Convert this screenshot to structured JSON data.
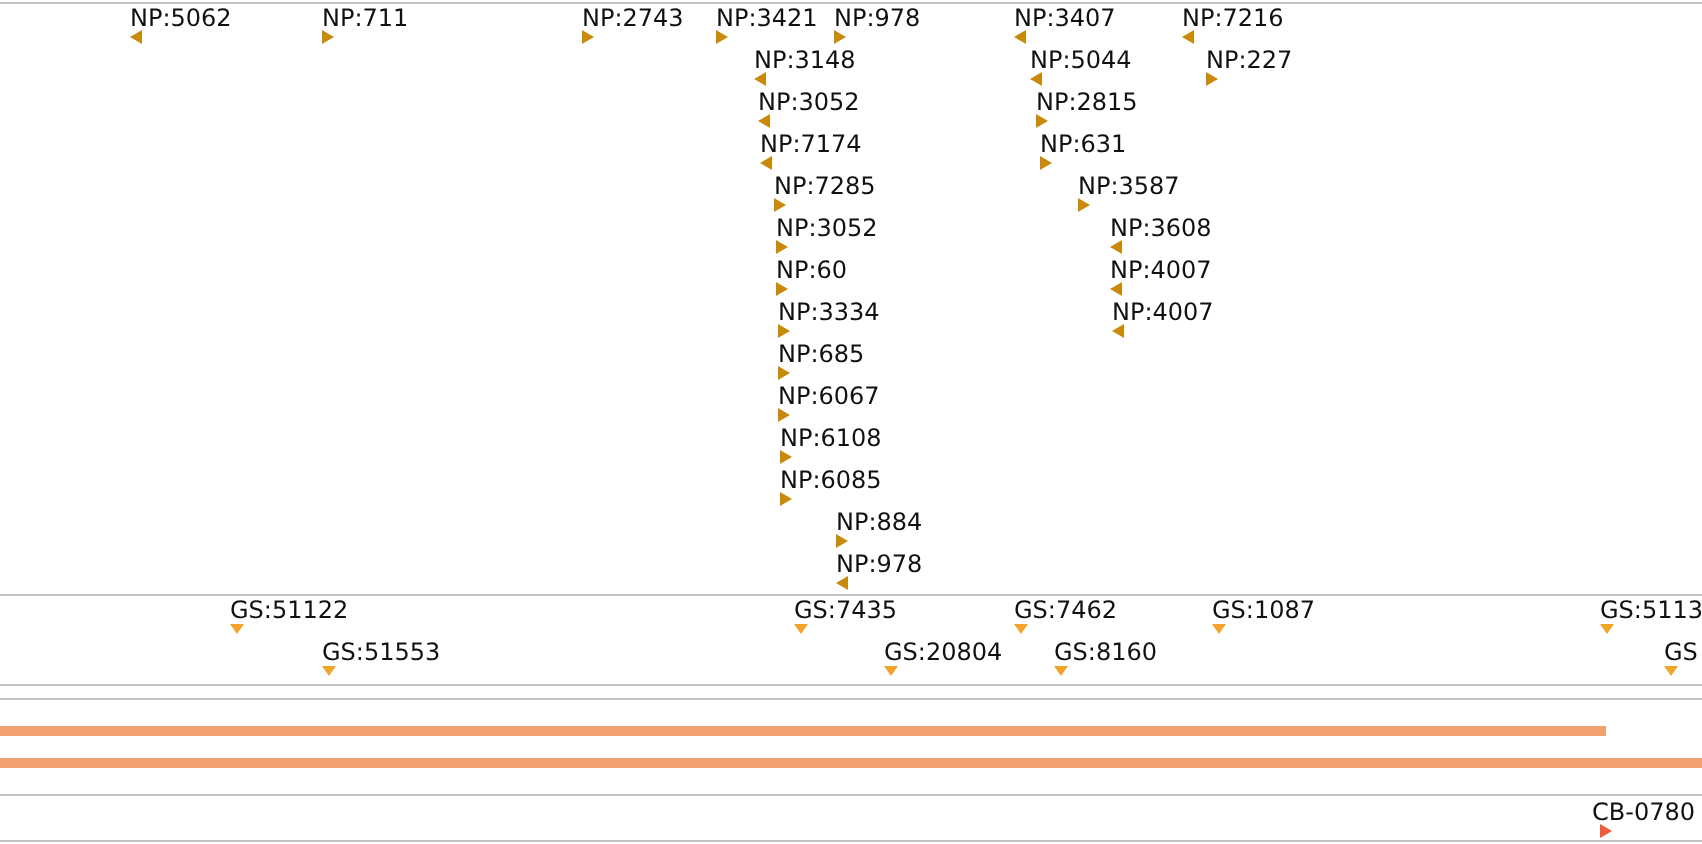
{
  "np_track": {
    "features": [
      {
        "label": "NP:5062",
        "kind": "left"
      },
      {
        "label": "NP:711",
        "kind": "right"
      },
      {
        "label": "NP:2743",
        "kind": "right"
      },
      {
        "label": "NP:3421",
        "kind": "right"
      },
      {
        "label": "NP:978",
        "kind": "right"
      },
      {
        "label": "NP:3407",
        "kind": "left"
      },
      {
        "label": "NP:7216",
        "kind": "left"
      },
      {
        "label": "NP:3148",
        "kind": "left"
      },
      {
        "label": "NP:5044",
        "kind": "left"
      },
      {
        "label": "NP:227",
        "kind": "right"
      },
      {
        "label": "NP:3052",
        "kind": "left"
      },
      {
        "label": "NP:2815",
        "kind": "right"
      },
      {
        "label": "NP:7174",
        "kind": "left"
      },
      {
        "label": "NP:631",
        "kind": "right"
      },
      {
        "label": "NP:7285",
        "kind": "right"
      },
      {
        "label": "NP:3587",
        "kind": "right"
      },
      {
        "label": "NP:3052",
        "kind": "right"
      },
      {
        "label": "NP:3608",
        "kind": "left"
      },
      {
        "label": "NP:60",
        "kind": "right"
      },
      {
        "label": "NP:4007",
        "kind": "left"
      },
      {
        "label": "NP:3334",
        "kind": "right"
      },
      {
        "label": "NP:4007",
        "kind": "left"
      },
      {
        "label": "NP:685",
        "kind": "right"
      },
      {
        "label": "NP:6067",
        "kind": "right"
      },
      {
        "label": "NP:6108",
        "kind": "right"
      },
      {
        "label": "NP:6085",
        "kind": "right"
      },
      {
        "label": "NP:884",
        "kind": "right"
      },
      {
        "label": "NP:978",
        "kind": "left"
      }
    ]
  },
  "gs_track": {
    "features": [
      {
        "label": "GS:51122",
        "kind": "down"
      },
      {
        "label": "GS:7435",
        "kind": "down"
      },
      {
        "label": "GS:7462",
        "kind": "down"
      },
      {
        "label": "GS:1087",
        "kind": "down"
      },
      {
        "label": "GS:5113",
        "kind": "down"
      },
      {
        "label": "GS:51553",
        "kind": "down"
      },
      {
        "label": "GS:20804",
        "kind": "down"
      },
      {
        "label": "GS:8160",
        "kind": "down"
      },
      {
        "label": "GS",
        "kind": "down"
      }
    ]
  },
  "cb_track": {
    "features": [
      {
        "label": "CB-0780",
        "kind": "right"
      }
    ]
  }
}
